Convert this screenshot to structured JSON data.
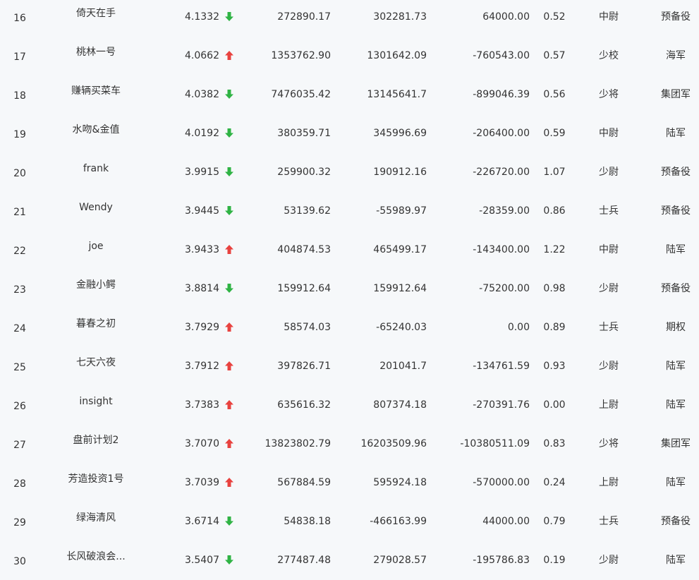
{
  "colors": {
    "up": "#e8423f",
    "down": "#2fb344",
    "text": "#333333",
    "background": "#f6f8fa"
  },
  "rows": [
    {
      "rank": "16",
      "name": "倚天在手",
      "score": "4.1332",
      "trend": "down",
      "v1": "272890.17",
      "v2": "302281.73",
      "v3": "64000.00",
      "ratio": "0.52",
      "title": "中尉",
      "branch": "预备役"
    },
    {
      "rank": "17",
      "name": "桃林一号",
      "score": "4.0662",
      "trend": "up",
      "v1": "1353762.90",
      "v2": "1301642.09",
      "v3": "-760543.00",
      "ratio": "0.57",
      "title": "少校",
      "branch": "海军"
    },
    {
      "rank": "18",
      "name": "赚辆买菜车",
      "score": "4.0382",
      "trend": "down",
      "v1": "7476035.42",
      "v2": "13145641.7",
      "v3": "-899046.39",
      "ratio": "0.56",
      "title": "少将",
      "branch": "集团军"
    },
    {
      "rank": "19",
      "name": "水吻&金值",
      "score": "4.0192",
      "trend": "down",
      "v1": "380359.71",
      "v2": "345996.69",
      "v3": "-206400.00",
      "ratio": "0.59",
      "title": "中尉",
      "branch": "陆军"
    },
    {
      "rank": "20",
      "name": "frank",
      "score": "3.9915",
      "trend": "down",
      "v1": "259900.32",
      "v2": "190912.16",
      "v3": "-226720.00",
      "ratio": "1.07",
      "title": "少尉",
      "branch": "预备役"
    },
    {
      "rank": "21",
      "name": "Wendy",
      "score": "3.9445",
      "trend": "down",
      "v1": "53139.62",
      "v2": "-55989.97",
      "v3": "-28359.00",
      "ratio": "0.86",
      "title": "士兵",
      "branch": "预备役"
    },
    {
      "rank": "22",
      "name": "joe",
      "score": "3.9433",
      "trend": "up",
      "v1": "404874.53",
      "v2": "465499.17",
      "v3": "-143400.00",
      "ratio": "1.22",
      "title": "中尉",
      "branch": "陆军"
    },
    {
      "rank": "23",
      "name": "金融小鳄",
      "score": "3.8814",
      "trend": "down",
      "v1": "159912.64",
      "v2": "159912.64",
      "v3": "-75200.00",
      "ratio": "0.98",
      "title": "少尉",
      "branch": "预备役"
    },
    {
      "rank": "24",
      "name": "暮春之初",
      "score": "3.7929",
      "trend": "up",
      "v1": "58574.03",
      "v2": "-65240.03",
      "v3": "0.00",
      "ratio": "0.89",
      "title": "士兵",
      "branch": "期权"
    },
    {
      "rank": "25",
      "name": "七天六夜",
      "score": "3.7912",
      "trend": "up",
      "v1": "397826.71",
      "v2": "201041.7",
      "v3": "-134761.59",
      "ratio": "0.93",
      "title": "少尉",
      "branch": "陆军"
    },
    {
      "rank": "26",
      "name": "insight",
      "score": "3.7383",
      "trend": "up",
      "v1": "635616.32",
      "v2": "807374.18",
      "v3": "-270391.76",
      "ratio": "0.00",
      "title": "上尉",
      "branch": "陆军"
    },
    {
      "rank": "27",
      "name": "盘前计划2",
      "score": "3.7070",
      "trend": "up",
      "v1": "13823802.79",
      "v2": "16203509.96",
      "v3": "-10380511.09",
      "ratio": "0.83",
      "title": "少将",
      "branch": "集团军"
    },
    {
      "rank": "28",
      "name": "芳造投资1号",
      "score": "3.7039",
      "trend": "up",
      "v1": "567884.59",
      "v2": "595924.18",
      "v3": "-570000.00",
      "ratio": "0.24",
      "title": "上尉",
      "branch": "陆军"
    },
    {
      "rank": "29",
      "name": "绿海清风",
      "score": "3.6714",
      "trend": "down",
      "v1": "54838.18",
      "v2": "-466163.99",
      "v3": "44000.00",
      "ratio": "0.79",
      "title": "士兵",
      "branch": "预备役"
    },
    {
      "rank": "30",
      "name": "长风破浪会...",
      "score": "3.5407",
      "trend": "down",
      "v1": "277487.48",
      "v2": "279028.57",
      "v3": "-195786.83",
      "ratio": "0.19",
      "title": "少尉",
      "branch": "陆军"
    }
  ]
}
